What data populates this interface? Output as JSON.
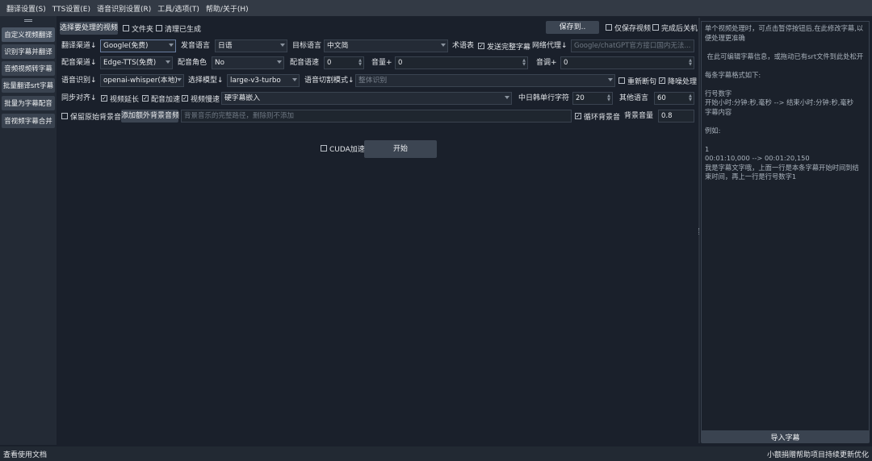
{
  "menu": [
    "翻译设置(S)",
    "TTS设置(E)",
    "语音识别设置(R)",
    "工具/选项(T)",
    "帮助/关于(H)"
  ],
  "sidebar": {
    "items": [
      "自定义视频翻译",
      "识别字幕并翻译",
      "音频视频转字幕",
      "批量翻译srt字幕",
      "批量为字幕配音",
      "音视频字幕合并"
    ]
  },
  "row1": {
    "select_video": "选择要处理的视频",
    "folder": "文件夹",
    "clear_generated": "清理已生成",
    "save_to": "保存到..",
    "only_save_video": "仅保存视频",
    "shutdown_after": "完成后关机"
  },
  "row2": {
    "translate_channel_label": "翻译渠道↓",
    "translate_channel": "Google(免费)",
    "source_lang_label": "发音语言",
    "source_lang": "日语",
    "target_lang_label": "目标语言",
    "target_lang": "中文简",
    "glossary_label": "术语表",
    "send_full_subtitle": "发送完整字幕",
    "proxy_label": "网络代理↓",
    "proxy_placeholder": "Google/chatGPT官方接口国内无法..."
  },
  "row3": {
    "dub_channel_label": "配音渠道↓",
    "dub_channel": "Edge-TTS(免费)",
    "voice_role_label": "配音角色",
    "voice_role": "No",
    "speed_label": "配音语速",
    "speed": "0",
    "volume_label": "音量+",
    "volume": "0",
    "pitch_label": "音调+",
    "pitch": "0"
  },
  "row4": {
    "asr_label": "语音识别↓",
    "asr": "openai-whisper(本地)",
    "model_label": "选择模型↓",
    "model": "large-v3-turbo",
    "split_label": "语音切割模式↓",
    "split": "整体识别",
    "resegment": "重新断句",
    "denoise": "降噪处理"
  },
  "row5": {
    "sync_label": "同步对齐↓",
    "video_extend": "视频延长",
    "dub_speedup": "配音加速",
    "video_slowdown": "视频慢速",
    "subtitle_mode": "硬字幕嵌入",
    "cjk_chars_label": "中日韩单行字符",
    "cjk_chars": "20",
    "other_lang_label": "其他语言",
    "other_lang": "60"
  },
  "row6": {
    "keep_bg": "保留原始背景音",
    "add_bg_button": "添加额外背景音频",
    "bg_placeholder": "背景音乐的完整路径，删除则不添加",
    "loop_bg": "循环背景音",
    "bg_volume_label": "背景音量",
    "bg_volume": "0.8"
  },
  "run": {
    "cuda": "CUDA加速",
    "start": "开始"
  },
  "right_panel": {
    "text": "单个视频处理时，可点击暂停按钮后,在此修改字幕,以便处理更准确\n\n 在此可编辑字幕信息，或拖动已有srt文件到此处松开\n\n每条字幕格式如下:\n\n行号数字\n开始小时:分钟:秒,毫秒 --> 结束小时:分钟:秒,毫秒\n字幕内容\n\n例如:\n\n1\n00:01:10,000 --> 00:01:20,150\n我是字幕文字哦，上面一行是本条字幕开始时间到结束时间，再上一行是行号数字1",
    "import_button": "导入字幕"
  },
  "status": {
    "left": "查看使用文档",
    "right": "小额捐赠帮助项目持续更新优化"
  }
}
